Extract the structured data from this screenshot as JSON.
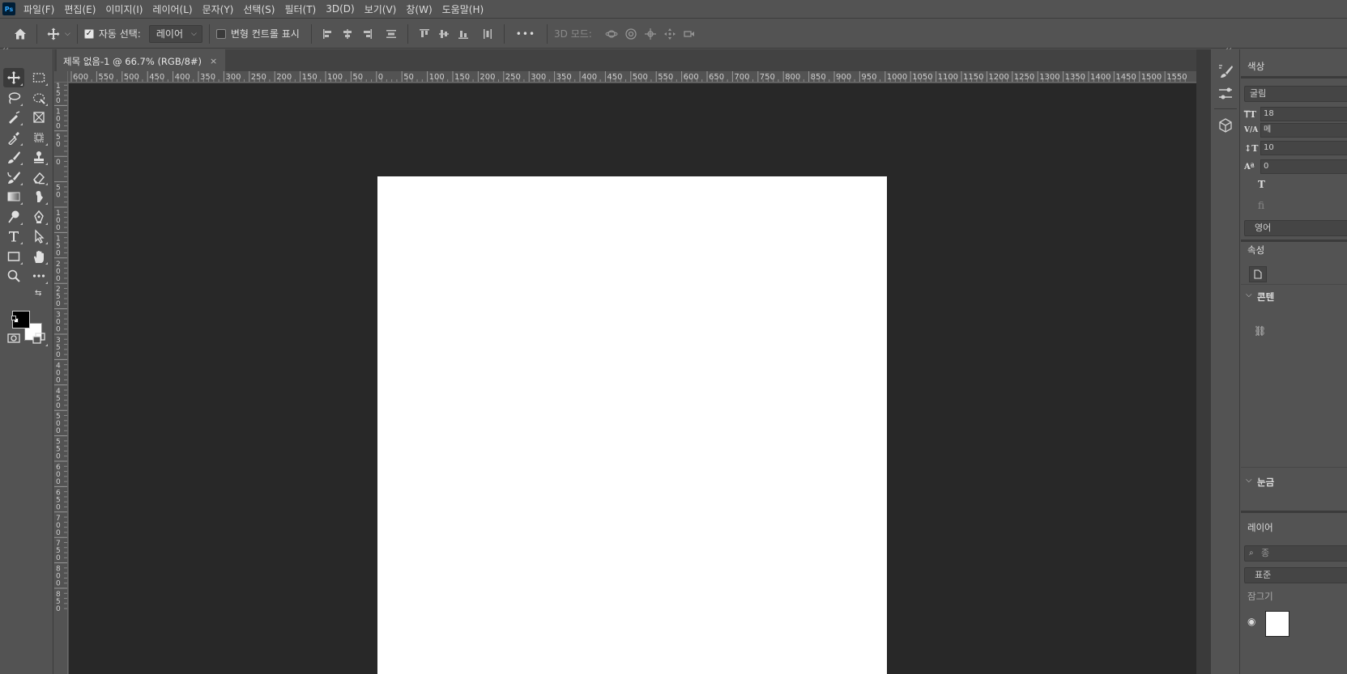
{
  "app": {
    "logo_text": "Ps"
  },
  "menu": {
    "items": [
      "파일(F)",
      "편집(E)",
      "이미지(I)",
      "레이어(L)",
      "문자(Y)",
      "선택(S)",
      "필터(T)",
      "3D(D)",
      "보기(V)",
      "창(W)",
      "도움말(H)"
    ]
  },
  "options": {
    "auto_select_label": "자동 선택:",
    "auto_select_checked": true,
    "auto_select_target": "레이어",
    "transform_controls_label": "변형 컨트롤 표시",
    "transform_controls_checked": false,
    "more_label": "•••",
    "mode_3d_label": "3D 모드:"
  },
  "document_tab": {
    "title": "제목 없음-1 @ 66.7% (RGB/8#)",
    "close_label": "×"
  },
  "rulers": {
    "top_labels": [
      "600",
      "550",
      "500",
      "450",
      "400",
      "350",
      "300",
      "250",
      "200",
      "150",
      "100",
      "50",
      "0",
      "50",
      "100",
      "150",
      "200",
      "250",
      "300",
      "350",
      "400",
      "450",
      "500",
      "550",
      "600",
      "650",
      "700",
      "750",
      "800",
      "850",
      "900",
      "950",
      "1000",
      "1050",
      "1100",
      "1150",
      "1200",
      "1250",
      "1300",
      "1350",
      "1400",
      "1450",
      "1500",
      "1550"
    ],
    "left_labels": [
      "150",
      "100",
      "50",
      "0",
      "50",
      "100",
      "150",
      "200",
      "250",
      "300",
      "350",
      "400",
      "450",
      "500",
      "550",
      "600",
      "650",
      "700",
      "750",
      "800",
      "850"
    ]
  },
  "toolbar": {
    "collapse_label": "‹‹",
    "tools": [
      "move-tool",
      "marquee-tool",
      "lasso-tool",
      "quick-select-tool",
      "brush-select-tool",
      "frame-tool",
      "eyedropper-tool",
      "crop-tool",
      "brush-tool",
      "stamp-tool",
      "history-brush-tool",
      "eraser-tool",
      "gradient-tool",
      "smudge-tool",
      "dodge-tool",
      "pen-tool",
      "type-tool",
      "path-select-tool",
      "rectangle-tool",
      "hand-tool",
      "zoom-tool",
      "more-tools"
    ]
  },
  "right_panel": {
    "collapse_label": "‹‹",
    "color_title": "색상",
    "font_field": "굴림",
    "char_size": "18",
    "char_tracking": "메",
    "char_leading": "10",
    "char_baseline": "0",
    "lang_field": "영어",
    "properties_title": "속성",
    "section_contents": "콘텐",
    "section_rulers": "눈금",
    "layers_title": "레이어",
    "layers_search": "종",
    "layers_blend": "표준",
    "layers_lock": "잠그기"
  },
  "colors": {
    "ui_bg": "#535353",
    "canvas_bg": "#282828",
    "document": "#ffffff",
    "foreground": "#000000",
    "background": "#ffffff"
  }
}
